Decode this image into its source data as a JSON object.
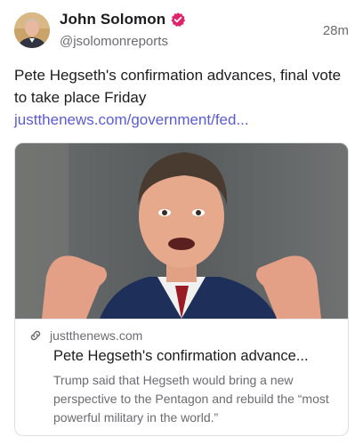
{
  "author": {
    "name": "John Solomon",
    "handle": "@jsolomonreports",
    "verified": true,
    "verified_color": "#e0246b"
  },
  "time": "28m",
  "post": {
    "text": "Pete Hegseth's confirmation advances, final vote to take place Friday ",
    "link_text": "justthenews.com/government/fed...",
    "link_color": "#5b5bd6"
  },
  "card": {
    "domain": "justthenews.com",
    "title": "Pete Hegseth's confirmation advance...",
    "description": "Trump said that Hegseth would bring a new perspective to the Pentagon and rebuild the “most powerful military in the world.”",
    "image_alt": "photo-of-speaker"
  },
  "icons": {
    "verified": "verified-badge-icon",
    "link": "link-icon"
  }
}
